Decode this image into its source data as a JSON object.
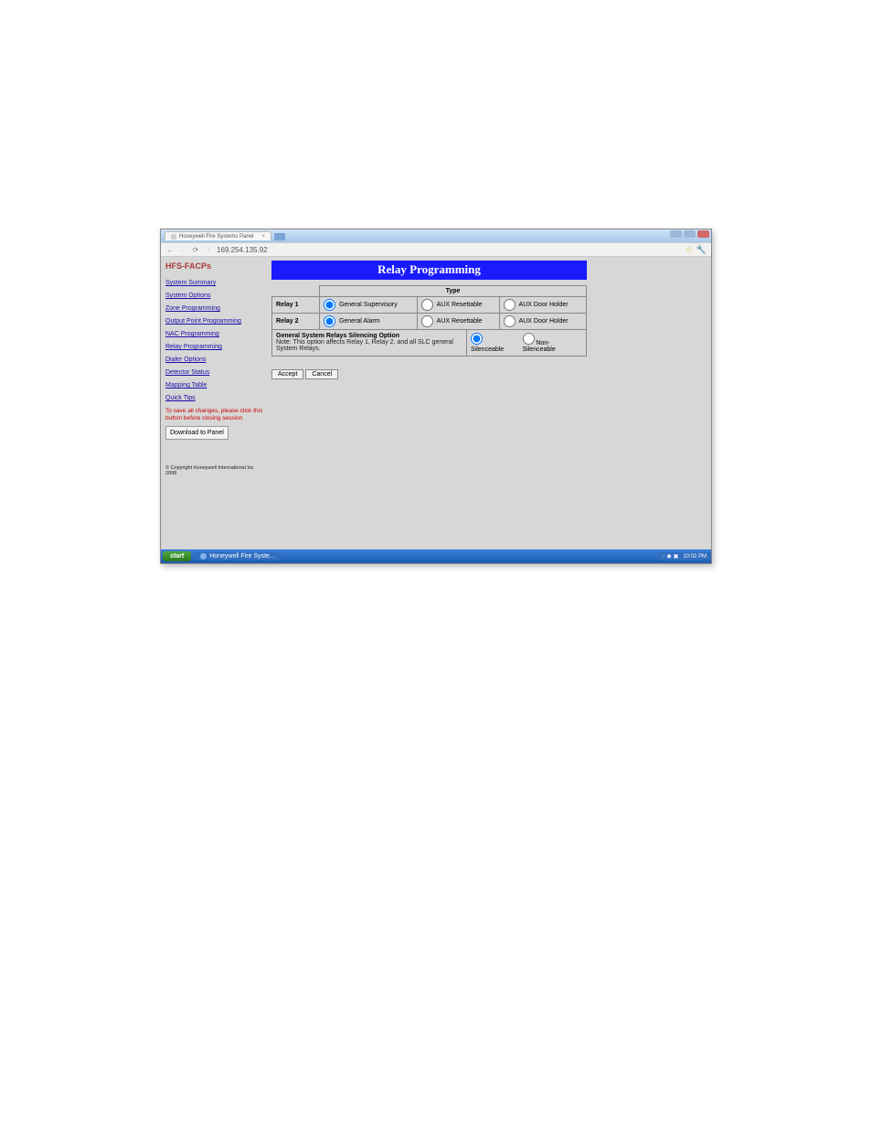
{
  "window": {
    "tab_title": "Honeywell Fire Systems Panel",
    "url": "169.254.135.92"
  },
  "sidebar": {
    "brand": "HFS-FACPs",
    "links": [
      "System Summary",
      "System Options",
      "Zone Programming",
      "Output Point Programming",
      "NAC Programming",
      "Relay Programming",
      "Dialer Options",
      "Detector Status",
      "Mapping Table",
      "Quick Tips"
    ],
    "save_warning": "To save all changes, please click this button before closing session",
    "download_btn": "Download to Panel",
    "copyright": "© Copyright Honeywell International Inc 2008"
  },
  "content": {
    "title": "Relay Programming",
    "type_header": "Type",
    "relay_rows": [
      {
        "label": "Relay 1",
        "opt1": "General Supervisory",
        "opt2": "AUX Resettable",
        "opt3": "AUX Door Holder",
        "selected": "opt1"
      },
      {
        "label": "Relay 2",
        "opt1": "General Alarm",
        "opt2": "AUX Resettable",
        "opt3": "AUX Door Holder",
        "selected": "opt1"
      }
    ],
    "silencing": {
      "title": "General System Relays Silencing Option",
      "note": "Note: This option affects Relay 1, Relay 2, and all SLC general System Relays.",
      "opt_silenceable": "Silenceable",
      "opt_nonsilenceable": "Non-Silenceable",
      "selected": "silenceable"
    },
    "buttons": {
      "accept": "Accept",
      "cancel": "Cancel"
    }
  },
  "taskbar": {
    "start": "start",
    "task_item": "Honeywell Fire Syste...",
    "clock": "10:02 PM"
  }
}
